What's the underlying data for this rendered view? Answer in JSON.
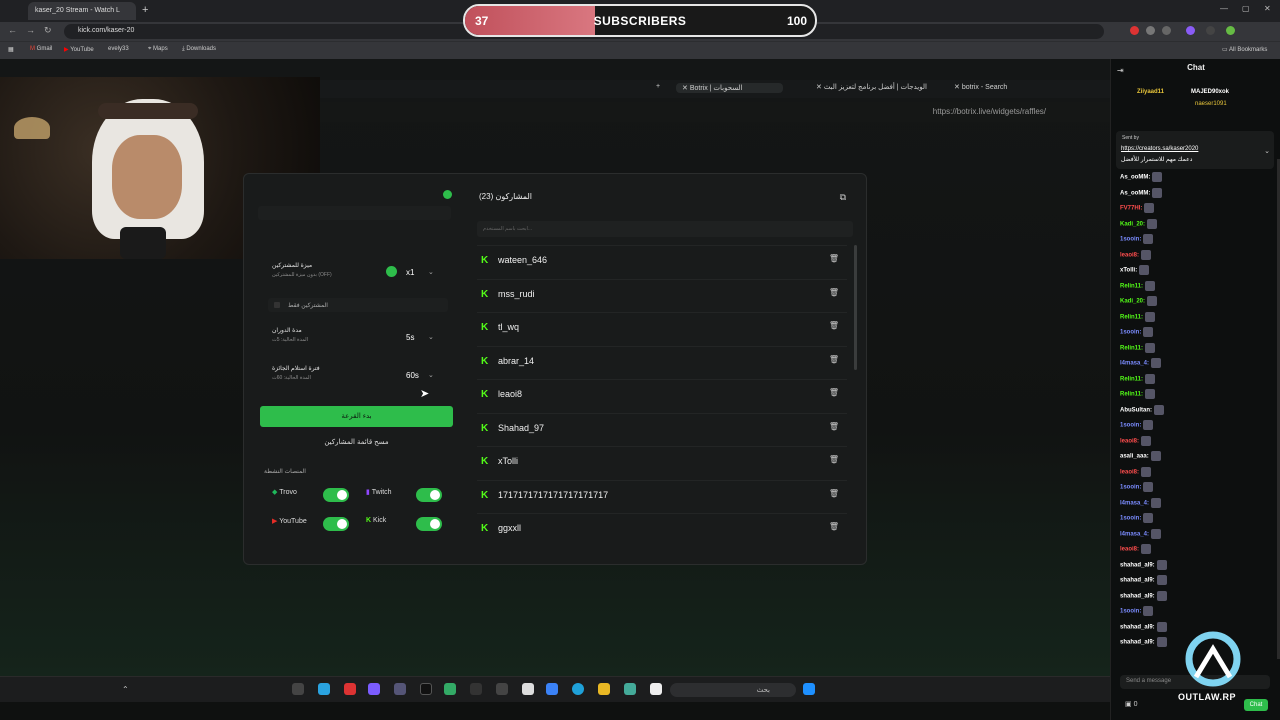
{
  "browser": {
    "tab_title": "kaser_20 Stream - Watch L",
    "url": "kick.com/kaser-20",
    "bookmarks": [
      "Gmail",
      "YouTube",
      "evely33",
      "Maps",
      "Downloads"
    ],
    "all_bookmarks": "All Bookmarks"
  },
  "subscribers": {
    "current": "37",
    "label": "SUBSCRIBERS",
    "goal": "100",
    "progress_fraction": 0.37
  },
  "inner_browser": {
    "tabs": [
      "Botrix | السحوبات",
      "الويدجات | أفضل برنامج لتعزيز البث",
      "botrix - Search"
    ],
    "url": "https://botrix.live/widgets/raffles/"
  },
  "settings": {
    "bonus_title": "ميزة للمشتركين",
    "bonus_sub": "بدون ميزة للمشتركين (OFF)",
    "bonus_value": "x1",
    "subs_only": "المشتركين فقط",
    "duration_title": "مدة الدوران",
    "duration_sub": "المدة الحالية: 5ث",
    "duration_value": "5s",
    "claim_title": "فترة استلام الجائزة",
    "claim_sub": "المدة الحالية: 60ث",
    "claim_value": "60s",
    "start_button": "بدء القرعة",
    "clear_button": "مسح قائمة المشاركين",
    "platforms_title": "المنصات النشطة",
    "platforms": [
      {
        "name": "Trovo",
        "enabled": true,
        "color": "#1fb85b"
      },
      {
        "name": "Twitch",
        "enabled": true,
        "color": "#9147ff"
      },
      {
        "name": "YouTube",
        "enabled": true,
        "color": "#e52d27"
      },
      {
        "name": "Kick",
        "enabled": true,
        "color": "#53fc18"
      }
    ]
  },
  "participants": {
    "header": "المشاركون (23)",
    "search_placeholder": "ابحث باسم المستخدم...",
    "kick_glyph": "K",
    "rows": [
      "wateen_646",
      "mss_rudi",
      "tl_wq",
      "abrar_14",
      "leaoi8",
      "Shahad_97",
      "xTolli",
      "1717171717171717171717",
      "ggxxll"
    ]
  },
  "taskbar": {
    "search_label": "بحث"
  },
  "chat": {
    "title": "Chat",
    "pinned_user": "Ziiyaad11",
    "pinned_user2": "MAJED90xok",
    "pinned_user3": "naeser1091",
    "sent_by": "Sent by",
    "pinned_link": "https://creators.sa/kaser2020",
    "pinned_text": "دعمك مهم للاستمرار للأفضل",
    "lines": [
      {
        "user": "As_ooMM:",
        "color": "#ffffff"
      },
      {
        "user": "As_ooMM:",
        "color": "#ffffff"
      },
      {
        "user": "FV77HI:",
        "color": "#ff4d4d"
      },
      {
        "user": "Kadi_20:",
        "color": "#53fc18"
      },
      {
        "user": "1sooin:",
        "color": "#7b8cff"
      },
      {
        "user": "leaoi8:",
        "color": "#ff4d4d"
      },
      {
        "user": "xTolli:",
        "color": "#ffffff"
      },
      {
        "user": "Relin11:",
        "color": "#53fc18"
      },
      {
        "user": "Kadi_20:",
        "color": "#53fc18"
      },
      {
        "user": "Relin11:",
        "color": "#53fc18"
      },
      {
        "user": "1sooin:",
        "color": "#7b8cff"
      },
      {
        "user": "Relin11:",
        "color": "#53fc18"
      },
      {
        "user": "l4masa_4:",
        "color": "#7b8cff"
      },
      {
        "user": "Relin11:",
        "color": "#53fc18"
      },
      {
        "user": "Relin11:",
        "color": "#53fc18"
      },
      {
        "user": "AbuSultan:",
        "color": "#ffffff"
      },
      {
        "user": "1sooin:",
        "color": "#7b8cff"
      },
      {
        "user": "leaoi8:",
        "color": "#ff4d4d"
      },
      {
        "user": "asali_aaa:",
        "color": "#ffffff"
      },
      {
        "user": "leaoi8:",
        "color": "#ff4d4d"
      },
      {
        "user": "1sooin:",
        "color": "#7b8cff"
      },
      {
        "user": "l4masa_4:",
        "color": "#7b8cff"
      },
      {
        "user": "1sooin:",
        "color": "#7b8cff"
      },
      {
        "user": "l4masa_4:",
        "color": "#7b8cff"
      },
      {
        "user": "leaoi8:",
        "color": "#ff4d4d"
      },
      {
        "user": "shahad_al9:",
        "color": "#ffffff"
      },
      {
        "user": "shahad_al9:",
        "color": "#ffffff"
      },
      {
        "user": "shahad_al9:",
        "color": "#ffffff"
      },
      {
        "user": "1sooin:",
        "color": "#7b8cff"
      },
      {
        "user": "shahad_al9:",
        "color": "#ffffff"
      },
      {
        "user": "shahad_al9:",
        "color": "#ffffff"
      }
    ],
    "input_placeholder": "Send a message",
    "send_button": "Chat",
    "viewer_count": "0"
  },
  "overlay_logo": "OUTLAW.RP"
}
